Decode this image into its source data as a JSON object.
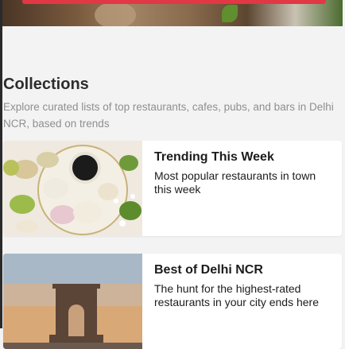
{
  "collections": {
    "title": "Collections",
    "subtitle": "Explore curated lists of top restaurants, cafes, pubs, and bars in Delhi NCR, based on trends",
    "cards": [
      {
        "title": "Trending This Week",
        "description": "Most popular restaurants in town this week"
      },
      {
        "title": "Best of Delhi NCR",
        "description": "The hunt for the highest-rated restaurants in your city ends here"
      }
    ]
  },
  "colors": {
    "accent": "#e23744",
    "page_background": "#f3f3f3",
    "subtitle_text": "#8f8f8f"
  }
}
